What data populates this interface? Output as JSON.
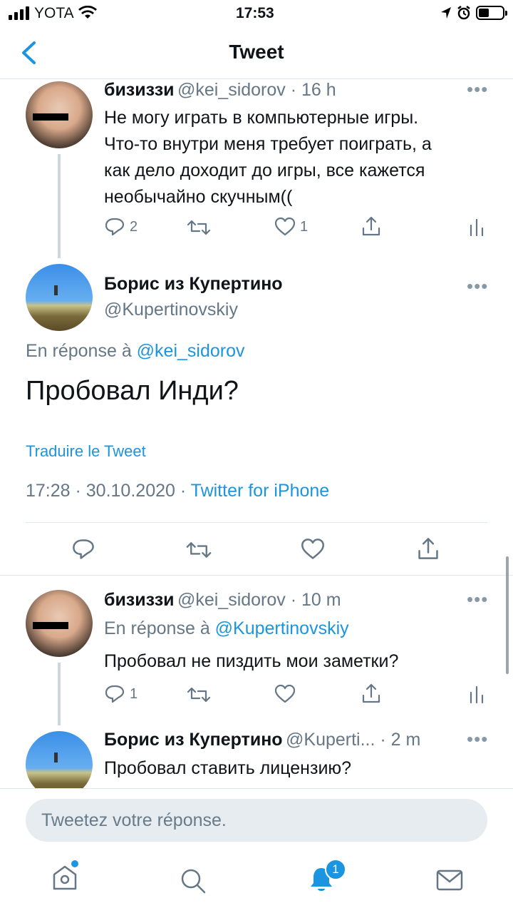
{
  "status_bar": {
    "carrier": "YOTA",
    "time": "17:53"
  },
  "header": {
    "title": "Tweet"
  },
  "tweet1": {
    "name": "бизиззи",
    "handle": "@kei_sidorov",
    "time": "16 h",
    "text_lines": [
      "Не могу играть в компьютерные игры.",
      "Что-то внутри меня требует поиграть, а",
      "как дело доходит до игры, все кажется",
      "необычайно скучным(("
    ],
    "reply_count": "2",
    "like_count": "1"
  },
  "main_tweet": {
    "name": "Борис из Купертино",
    "handle": "@Kupertinovskiy",
    "reply_prefix": "En réponse à",
    "reply_to": "@kei_sidorov",
    "text": "Пробовал Инди?",
    "translate": "Traduire le Tweet",
    "timestamp": "17:28 · 30.10.2020 ·",
    "source": "Twitter for iPhone"
  },
  "tweet3": {
    "name": "бизиззи",
    "handle": "@kei_sidorov",
    "time": "10 m",
    "reply_prefix": "En réponse à",
    "reply_to": "@Kupertinovskiy",
    "text": "Пробовал не пиздить мои заметки?",
    "reply_count": "1"
  },
  "tweet4": {
    "name": "Борис из Купертино",
    "handle": "@Kuperti...",
    "time": "2 m",
    "text": "Пробовал ставить лицензию?"
  },
  "compose": {
    "placeholder": "Tweetez votre réponse."
  },
  "tab_bar": {
    "notification_badge": "1"
  },
  "colors": {
    "accent": "#1b95e0",
    "secondary_text": "#657786",
    "divider": "#e1e8ed"
  }
}
